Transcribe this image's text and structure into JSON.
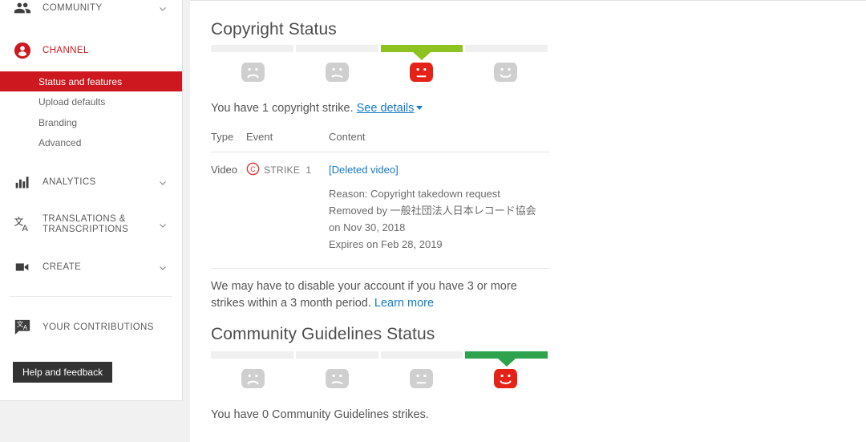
{
  "sidebar": {
    "groups": [
      {
        "label": "COMMUNITY",
        "icon": "people-icon",
        "expandable": true,
        "active": false
      },
      {
        "label": "CHANNEL",
        "icon": "account-circle-icon",
        "expandable": true,
        "active": true
      },
      {
        "label": "ANALYTICS",
        "icon": "bar-chart-icon",
        "expandable": true,
        "active": false
      },
      {
        "label": "TRANSLATIONS & TRANSCRIPTIONS",
        "icon": "translate-icon",
        "expandable": true,
        "active": false
      },
      {
        "label": "CREATE",
        "icon": "video-camera-icon",
        "expandable": true,
        "active": false
      }
    ],
    "channel_items": [
      {
        "label": "Status and features",
        "selected": true
      },
      {
        "label": "Upload defaults",
        "selected": false
      },
      {
        "label": "Branding",
        "selected": false
      },
      {
        "label": "Advanced",
        "selected": false
      }
    ],
    "contributions": {
      "label": "YOUR CONTRIBUTIONS",
      "icon": "translate-bubble-icon"
    },
    "help_button": "Help and feedback",
    "accent_color": "#cc181e",
    "active_item_bg": "#cc181e"
  },
  "copyright": {
    "title": "Copyright Status",
    "meter": {
      "segments": 4,
      "active_index": 2,
      "active_color": "#8dc220",
      "inactive_color": "#f0f0f0",
      "faces": [
        "sad-face",
        "slight-frown-face",
        "neutral-face",
        "happy-face"
      ],
      "highlighted_face_index": 2,
      "highlighted_face_color": "#e62117"
    },
    "summary_prefix": "You have 1 copyright strike.",
    "details_link": "See details",
    "table": {
      "headers": [
        "Type",
        "Event",
        "Content"
      ],
      "rows": [
        {
          "type": "Video",
          "event_icon": "copyright-icon",
          "event_label": "STRIKE",
          "event_count": "1",
          "content_link": "[Deleted video]",
          "content_lines": [
            "Reason: Copyright takedown request",
            "Removed by 一般社団法人日本レコード協会 on Nov 30, 2018",
            "Expires on Feb 28, 2019"
          ]
        }
      ]
    },
    "warning_text": "We may have to disable your account if you have 3 or more strikes within a 3 month period.",
    "warning_link": "Learn more"
  },
  "community_guidelines": {
    "title": "Community Guidelines Status",
    "meter": {
      "segments": 4,
      "active_index": 3,
      "active_color": "#2ea24d",
      "inactive_color": "#f0f0f0",
      "faces": [
        "sad-face",
        "slight-frown-face",
        "neutral-face",
        "happy-face"
      ],
      "highlighted_face_index": 3,
      "highlighted_face_color": "#e62117"
    },
    "summary": "You have 0 Community Guidelines strikes."
  }
}
